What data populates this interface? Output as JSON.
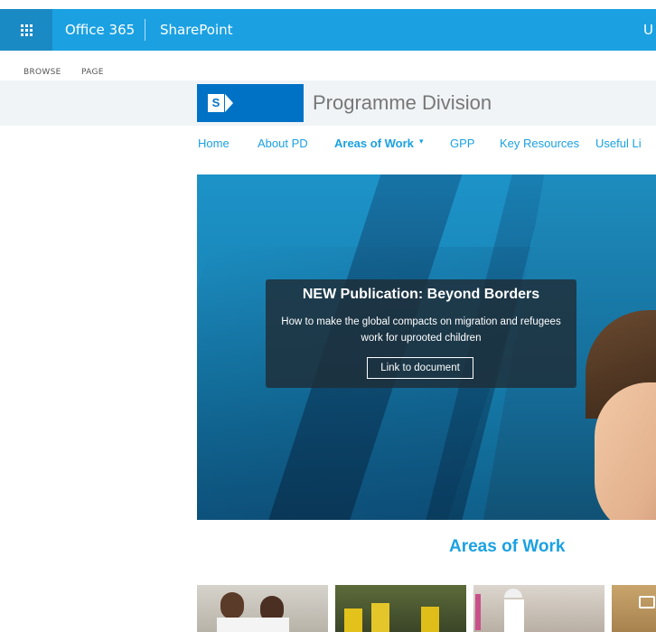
{
  "suitebar": {
    "app_name": "Office 365",
    "product": "SharePoint",
    "user_initial": "U"
  },
  "ribbon": {
    "tabs": [
      "BROWSE",
      "PAGE"
    ]
  },
  "site": {
    "logo_letter": "S",
    "title": "Programme Division"
  },
  "nav": {
    "items": [
      "Home",
      "About PD",
      "Areas of Work",
      "GPP",
      "Key Resources",
      "Useful Li"
    ],
    "caret": "▾"
  },
  "hero": {
    "title": "NEW Publication: Beyond Borders",
    "description": "How to make the global compacts on migration and refugees work for uprooted children",
    "button_label": "Link to document"
  },
  "section": {
    "title": "Areas of Work"
  },
  "colors": {
    "accent": "#1ba1e2",
    "suitebar": "#1ba1e2",
    "logo": "#0072c6"
  }
}
